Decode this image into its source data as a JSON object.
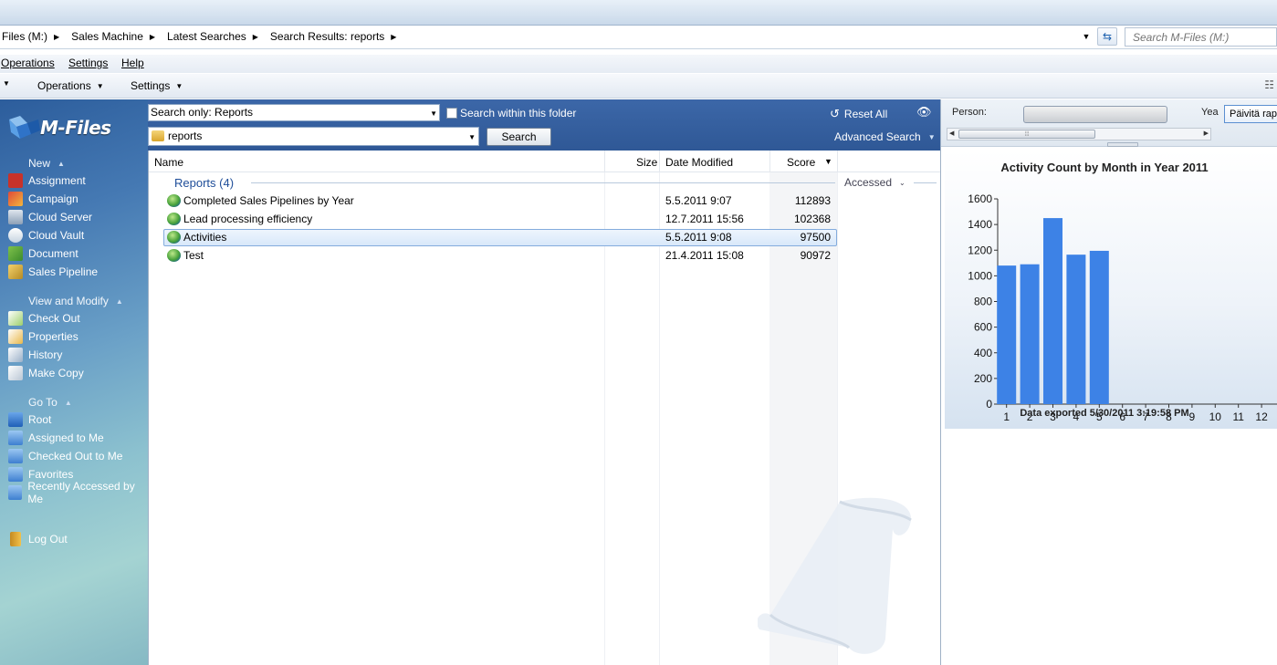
{
  "breadcrumbs": [
    "Files (M:)",
    "Sales Machine",
    "Latest Searches",
    "Search Results: reports"
  ],
  "address_search": {
    "placeholder": "Search M-Files (M:)"
  },
  "menubar": {
    "operations": "Operations",
    "settings": "Settings",
    "help": "Help"
  },
  "toolbar": {
    "operations": "Operations",
    "settings": "Settings"
  },
  "logo": {
    "text": "M-Files"
  },
  "task_pane": {
    "new": {
      "title": "New",
      "items": [
        "Assignment",
        "Campaign",
        "Cloud Server",
        "Cloud Vault",
        "Document",
        "Sales Pipeline"
      ]
    },
    "view_modify": {
      "title": "View and Modify",
      "items": [
        "Check Out",
        "Properties",
        "History",
        "Make Copy"
      ]
    },
    "goto": {
      "title": "Go To",
      "items": [
        "Root",
        "Assigned to Me",
        "Checked Out to Me",
        "Favorites",
        "Recently Accessed by Me"
      ]
    },
    "logout": "Log Out"
  },
  "search": {
    "scope": "Search only: Reports",
    "within_label": "Search within this folder",
    "query": "reports",
    "button": "Search",
    "reset_all": "Reset All",
    "advanced": "Advanced Search"
  },
  "listing": {
    "columns": {
      "name": "Name",
      "size": "Size",
      "date": "Date Modified",
      "score": "Score"
    },
    "group": "Reports (4)",
    "accessed": "Accessed",
    "rows": [
      {
        "name": "Completed Sales Pipelines by Year",
        "date": "5.5.2011 9:07",
        "score": "112893",
        "selected": false
      },
      {
        "name": "Lead processing efficiency",
        "date": "12.7.2011 15:56",
        "score": "102368",
        "selected": false
      },
      {
        "name": "Activities",
        "date": "5.5.2011 9:08",
        "score": "97500",
        "selected": true
      },
      {
        "name": "Test",
        "date": "21.4.2011 15:08",
        "score": "90972",
        "selected": false
      }
    ]
  },
  "report_filters": {
    "person_label": "Person:",
    "year_label": "Yea",
    "update_button": "Päivitä rapo"
  },
  "chart_data": {
    "type": "bar",
    "title": "Activity Count by Month in Year 2011",
    "footer": "Data exported 5/30/2011 3:19:58 PM",
    "categories": [
      "1",
      "2",
      "3",
      "4",
      "5",
      "6",
      "7",
      "8",
      "9",
      "10",
      "11",
      "12"
    ],
    "values": [
      1080,
      1090,
      1450,
      1165,
      1195,
      0,
      0,
      0,
      0,
      0,
      0,
      0
    ],
    "ylim": [
      0,
      1600
    ],
    "yticks": [
      0,
      200,
      400,
      600,
      800,
      1000,
      1200,
      1400,
      1600
    ],
    "bar_color": "#3d82e6",
    "grid": false
  }
}
